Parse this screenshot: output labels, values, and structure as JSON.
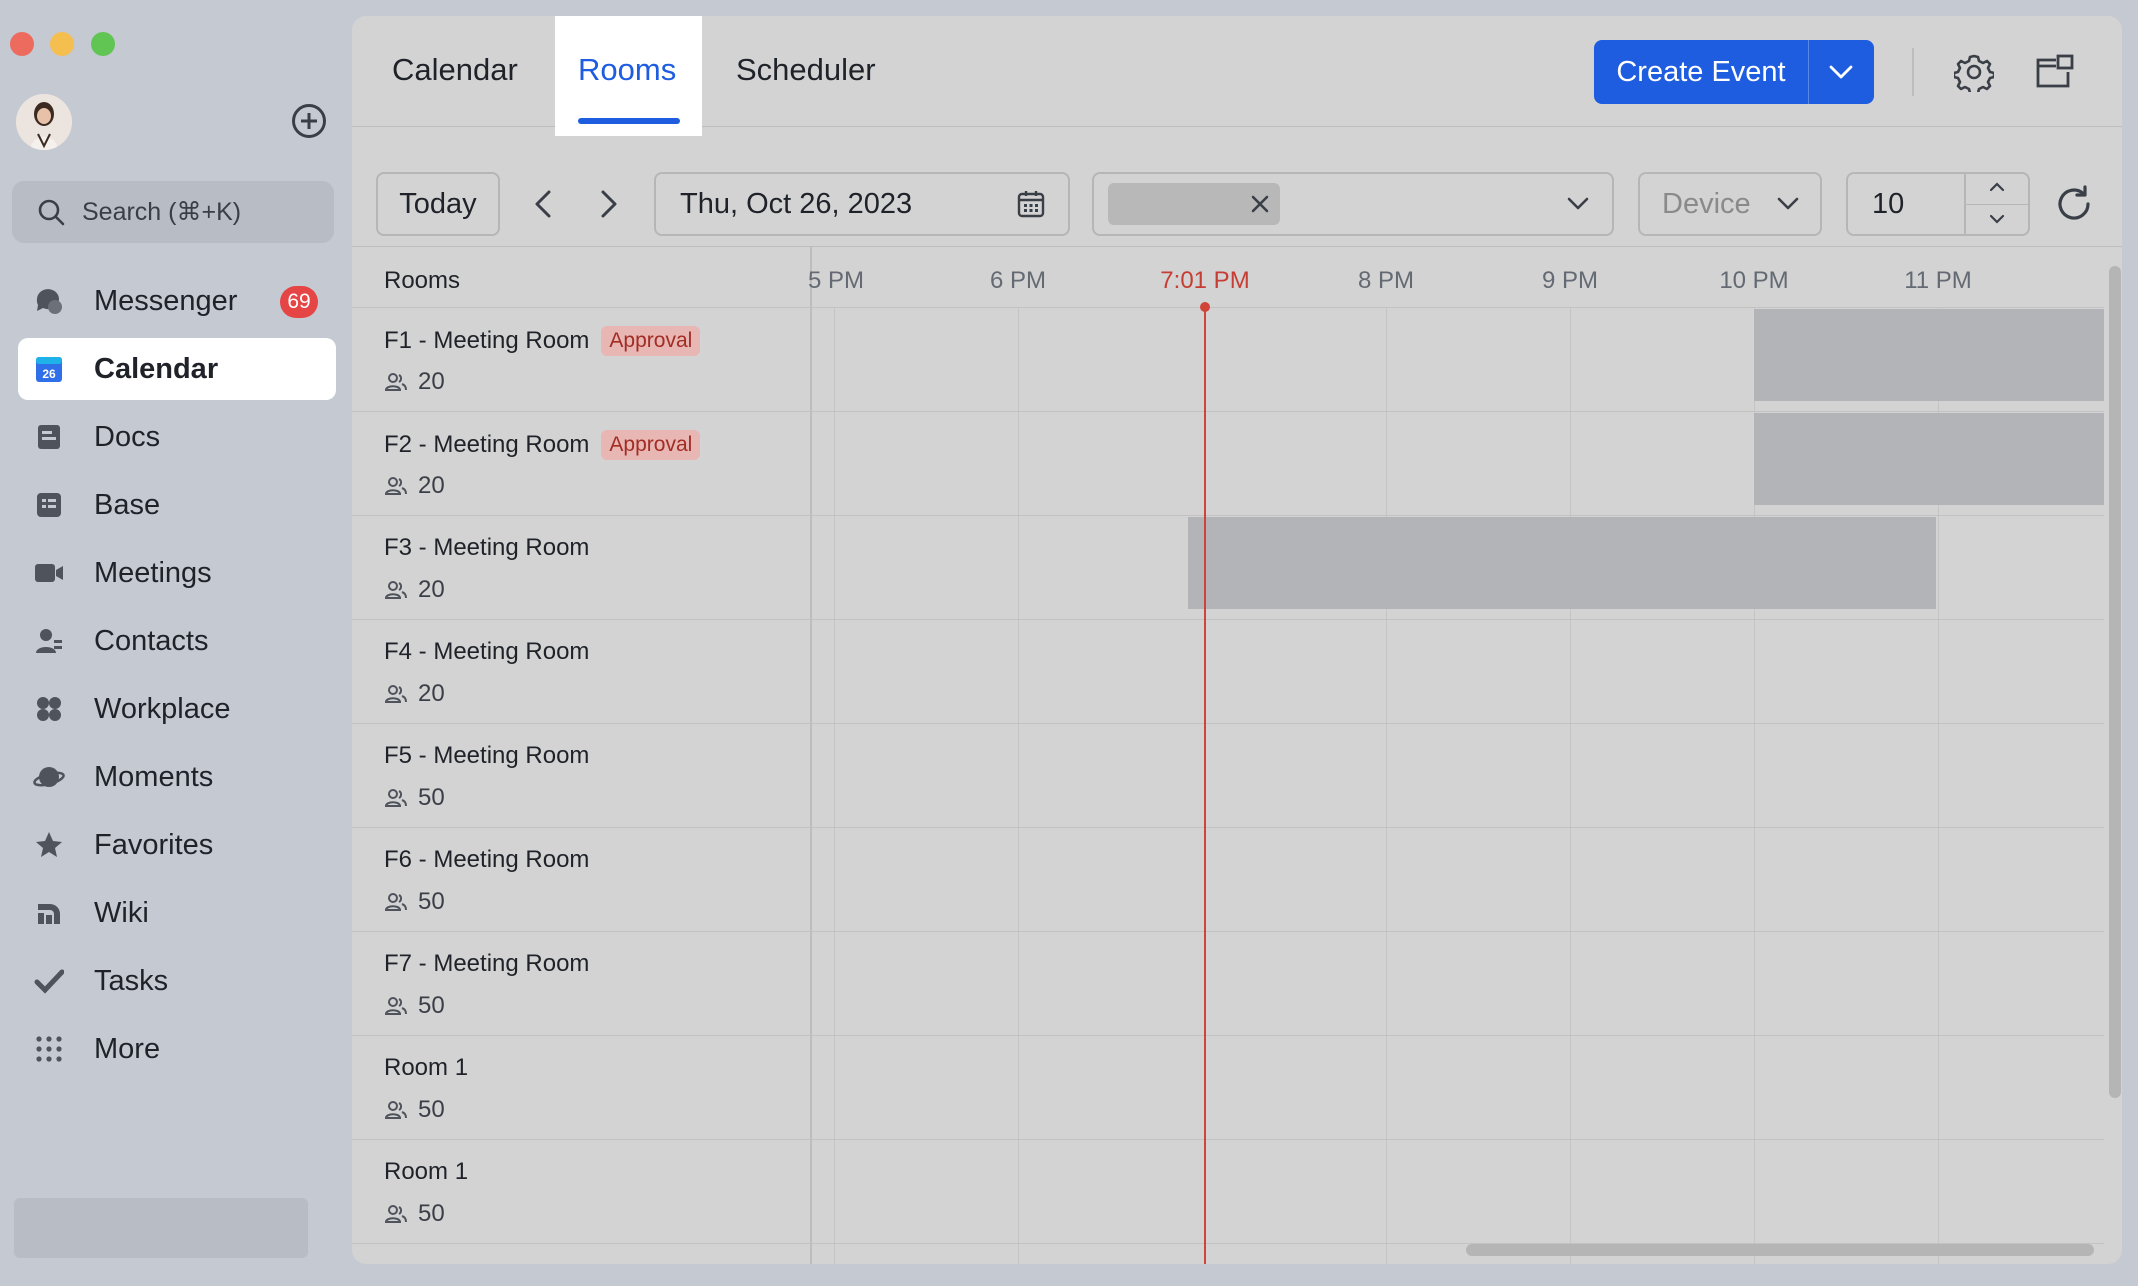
{
  "sidebar": {
    "search_placeholder": "Search (⌘+K)",
    "items": [
      {
        "label": "Messenger",
        "icon": "messenger-icon",
        "badge": "69"
      },
      {
        "label": "Calendar",
        "icon": "calendar-icon",
        "active": true,
        "icon_text": "26"
      },
      {
        "label": "Docs",
        "icon": "docs-icon"
      },
      {
        "label": "Base",
        "icon": "base-icon"
      },
      {
        "label": "Meetings",
        "icon": "meetings-icon"
      },
      {
        "label": "Contacts",
        "icon": "contacts-icon"
      },
      {
        "label": "Workplace",
        "icon": "workplace-icon"
      },
      {
        "label": "Moments",
        "icon": "moments-icon"
      },
      {
        "label": "Favorites",
        "icon": "star-icon"
      },
      {
        "label": "Wiki",
        "icon": "wiki-icon"
      },
      {
        "label": "Tasks",
        "icon": "tasks-icon"
      },
      {
        "label": "More",
        "icon": "more-grid-icon"
      }
    ]
  },
  "tabs": [
    {
      "label": "Calendar"
    },
    {
      "label": "Rooms",
      "active": true
    },
    {
      "label": "Scheduler"
    }
  ],
  "header": {
    "create_event_label": "Create Event"
  },
  "toolbar": {
    "today_label": "Today",
    "date_value": "Thu, Oct 26, 2023",
    "device_placeholder": "Device",
    "stepper_value": "10"
  },
  "grid": {
    "rooms_header": "Rooms",
    "hours": [
      "5 PM",
      "6 PM",
      "7:01 PM",
      "8 PM",
      "9 PM",
      "10 PM",
      "11 PM"
    ],
    "rooms": [
      {
        "name": "F1 - Meeting Room",
        "approval": "Approval",
        "capacity": "20"
      },
      {
        "name": "F2 - Meeting Room",
        "approval": "Approval",
        "capacity": "20"
      },
      {
        "name": "F3 - Meeting Room",
        "capacity": "20"
      },
      {
        "name": "F4 - Meeting Room",
        "capacity": "20"
      },
      {
        "name": "F5 - Meeting Room",
        "capacity": "50"
      },
      {
        "name": "F6 - Meeting Room",
        "capacity": "50"
      },
      {
        "name": "F7 - Meeting Room",
        "capacity": "50"
      },
      {
        "name": "Room 1",
        "capacity": "50"
      },
      {
        "name": "Room 1",
        "capacity": "50"
      }
    ]
  },
  "colors": {
    "accent": "#1e5ce0",
    "now_line": "#d14238",
    "badge": "#e54545",
    "approval_bg": "#e8b6b3",
    "approval_text": "#a12d25"
  }
}
